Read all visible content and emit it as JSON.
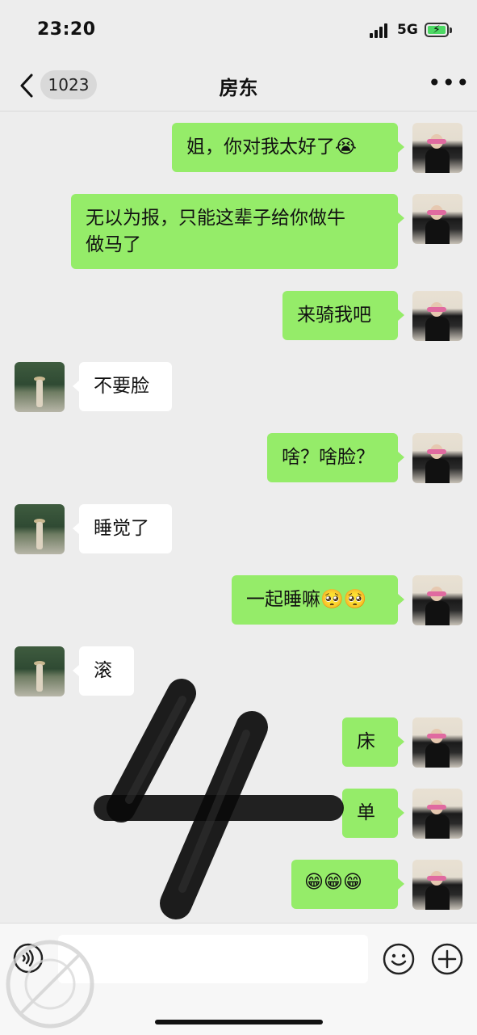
{
  "status": {
    "time": "23:20",
    "network": "5G",
    "battery_bolt": "⚡"
  },
  "header": {
    "unread_count": "1023",
    "title": "房东",
    "more": "•••"
  },
  "messages": [
    {
      "side": "me",
      "text": "姐，你对我太好了😭"
    },
    {
      "side": "me",
      "text": "无以为报，只能这辈子给你做牛",
      "text2": "做马了"
    },
    {
      "side": "me",
      "text": "来骑我吧"
    },
    {
      "side": "other",
      "text": "不要脸"
    },
    {
      "side": "me",
      "text": "啥？啥脸？"
    },
    {
      "side": "other",
      "text": "睡觉了"
    },
    {
      "side": "me",
      "text": "一起睡嘛🥺🥺"
    },
    {
      "side": "other",
      "text": "滚"
    },
    {
      "side": "me",
      "text": "床"
    },
    {
      "side": "me",
      "text": "单"
    },
    {
      "side": "me",
      "text": "😁😁😁"
    }
  ],
  "input": {
    "placeholder": ""
  },
  "icons": {
    "back": "chevron-left-icon",
    "more": "more-dots-icon",
    "voice": "voice-icon",
    "emoji": "emoji-icon",
    "plus": "plus-icon"
  },
  "colors": {
    "my_bubble": "#95ec69",
    "their_bubble": "#ffffff",
    "background": "#ededed"
  }
}
